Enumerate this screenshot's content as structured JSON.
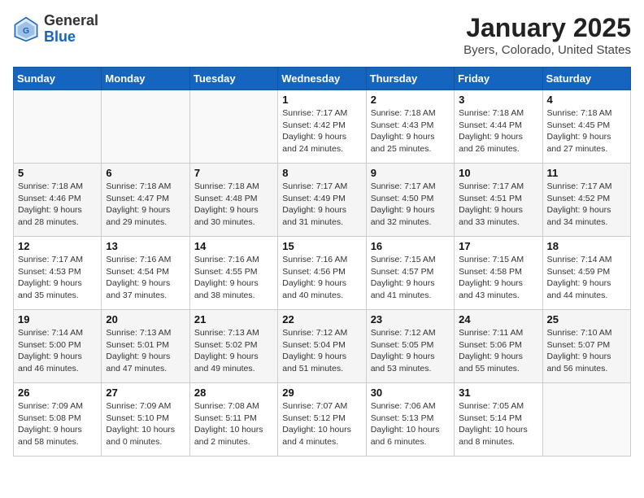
{
  "header": {
    "logo_general": "General",
    "logo_blue": "Blue",
    "month": "January 2025",
    "location": "Byers, Colorado, United States"
  },
  "weekdays": [
    "Sunday",
    "Monday",
    "Tuesday",
    "Wednesday",
    "Thursday",
    "Friday",
    "Saturday"
  ],
  "weeks": [
    [
      {
        "day": "",
        "info": ""
      },
      {
        "day": "",
        "info": ""
      },
      {
        "day": "",
        "info": ""
      },
      {
        "day": "1",
        "info": "Sunrise: 7:17 AM\nSunset: 4:42 PM\nDaylight: 9 hours\nand 24 minutes."
      },
      {
        "day": "2",
        "info": "Sunrise: 7:18 AM\nSunset: 4:43 PM\nDaylight: 9 hours\nand 25 minutes."
      },
      {
        "day": "3",
        "info": "Sunrise: 7:18 AM\nSunset: 4:44 PM\nDaylight: 9 hours\nand 26 minutes."
      },
      {
        "day": "4",
        "info": "Sunrise: 7:18 AM\nSunset: 4:45 PM\nDaylight: 9 hours\nand 27 minutes."
      }
    ],
    [
      {
        "day": "5",
        "info": "Sunrise: 7:18 AM\nSunset: 4:46 PM\nDaylight: 9 hours\nand 28 minutes."
      },
      {
        "day": "6",
        "info": "Sunrise: 7:18 AM\nSunset: 4:47 PM\nDaylight: 9 hours\nand 29 minutes."
      },
      {
        "day": "7",
        "info": "Sunrise: 7:18 AM\nSunset: 4:48 PM\nDaylight: 9 hours\nand 30 minutes."
      },
      {
        "day": "8",
        "info": "Sunrise: 7:17 AM\nSunset: 4:49 PM\nDaylight: 9 hours\nand 31 minutes."
      },
      {
        "day": "9",
        "info": "Sunrise: 7:17 AM\nSunset: 4:50 PM\nDaylight: 9 hours\nand 32 minutes."
      },
      {
        "day": "10",
        "info": "Sunrise: 7:17 AM\nSunset: 4:51 PM\nDaylight: 9 hours\nand 33 minutes."
      },
      {
        "day": "11",
        "info": "Sunrise: 7:17 AM\nSunset: 4:52 PM\nDaylight: 9 hours\nand 34 minutes."
      }
    ],
    [
      {
        "day": "12",
        "info": "Sunrise: 7:17 AM\nSunset: 4:53 PM\nDaylight: 9 hours\nand 35 minutes."
      },
      {
        "day": "13",
        "info": "Sunrise: 7:16 AM\nSunset: 4:54 PM\nDaylight: 9 hours\nand 37 minutes."
      },
      {
        "day": "14",
        "info": "Sunrise: 7:16 AM\nSunset: 4:55 PM\nDaylight: 9 hours\nand 38 minutes."
      },
      {
        "day": "15",
        "info": "Sunrise: 7:16 AM\nSunset: 4:56 PM\nDaylight: 9 hours\nand 40 minutes."
      },
      {
        "day": "16",
        "info": "Sunrise: 7:15 AM\nSunset: 4:57 PM\nDaylight: 9 hours\nand 41 minutes."
      },
      {
        "day": "17",
        "info": "Sunrise: 7:15 AM\nSunset: 4:58 PM\nDaylight: 9 hours\nand 43 minutes."
      },
      {
        "day": "18",
        "info": "Sunrise: 7:14 AM\nSunset: 4:59 PM\nDaylight: 9 hours\nand 44 minutes."
      }
    ],
    [
      {
        "day": "19",
        "info": "Sunrise: 7:14 AM\nSunset: 5:00 PM\nDaylight: 9 hours\nand 46 minutes."
      },
      {
        "day": "20",
        "info": "Sunrise: 7:13 AM\nSunset: 5:01 PM\nDaylight: 9 hours\nand 47 minutes."
      },
      {
        "day": "21",
        "info": "Sunrise: 7:13 AM\nSunset: 5:02 PM\nDaylight: 9 hours\nand 49 minutes."
      },
      {
        "day": "22",
        "info": "Sunrise: 7:12 AM\nSunset: 5:04 PM\nDaylight: 9 hours\nand 51 minutes."
      },
      {
        "day": "23",
        "info": "Sunrise: 7:12 AM\nSunset: 5:05 PM\nDaylight: 9 hours\nand 53 minutes."
      },
      {
        "day": "24",
        "info": "Sunrise: 7:11 AM\nSunset: 5:06 PM\nDaylight: 9 hours\nand 55 minutes."
      },
      {
        "day": "25",
        "info": "Sunrise: 7:10 AM\nSunset: 5:07 PM\nDaylight: 9 hours\nand 56 minutes."
      }
    ],
    [
      {
        "day": "26",
        "info": "Sunrise: 7:09 AM\nSunset: 5:08 PM\nDaylight: 9 hours\nand 58 minutes."
      },
      {
        "day": "27",
        "info": "Sunrise: 7:09 AM\nSunset: 5:10 PM\nDaylight: 10 hours\nand 0 minutes."
      },
      {
        "day": "28",
        "info": "Sunrise: 7:08 AM\nSunset: 5:11 PM\nDaylight: 10 hours\nand 2 minutes."
      },
      {
        "day": "29",
        "info": "Sunrise: 7:07 AM\nSunset: 5:12 PM\nDaylight: 10 hours\nand 4 minutes."
      },
      {
        "day": "30",
        "info": "Sunrise: 7:06 AM\nSunset: 5:13 PM\nDaylight: 10 hours\nand 6 minutes."
      },
      {
        "day": "31",
        "info": "Sunrise: 7:05 AM\nSunset: 5:14 PM\nDaylight: 10 hours\nand 8 minutes."
      },
      {
        "day": "",
        "info": ""
      }
    ]
  ]
}
